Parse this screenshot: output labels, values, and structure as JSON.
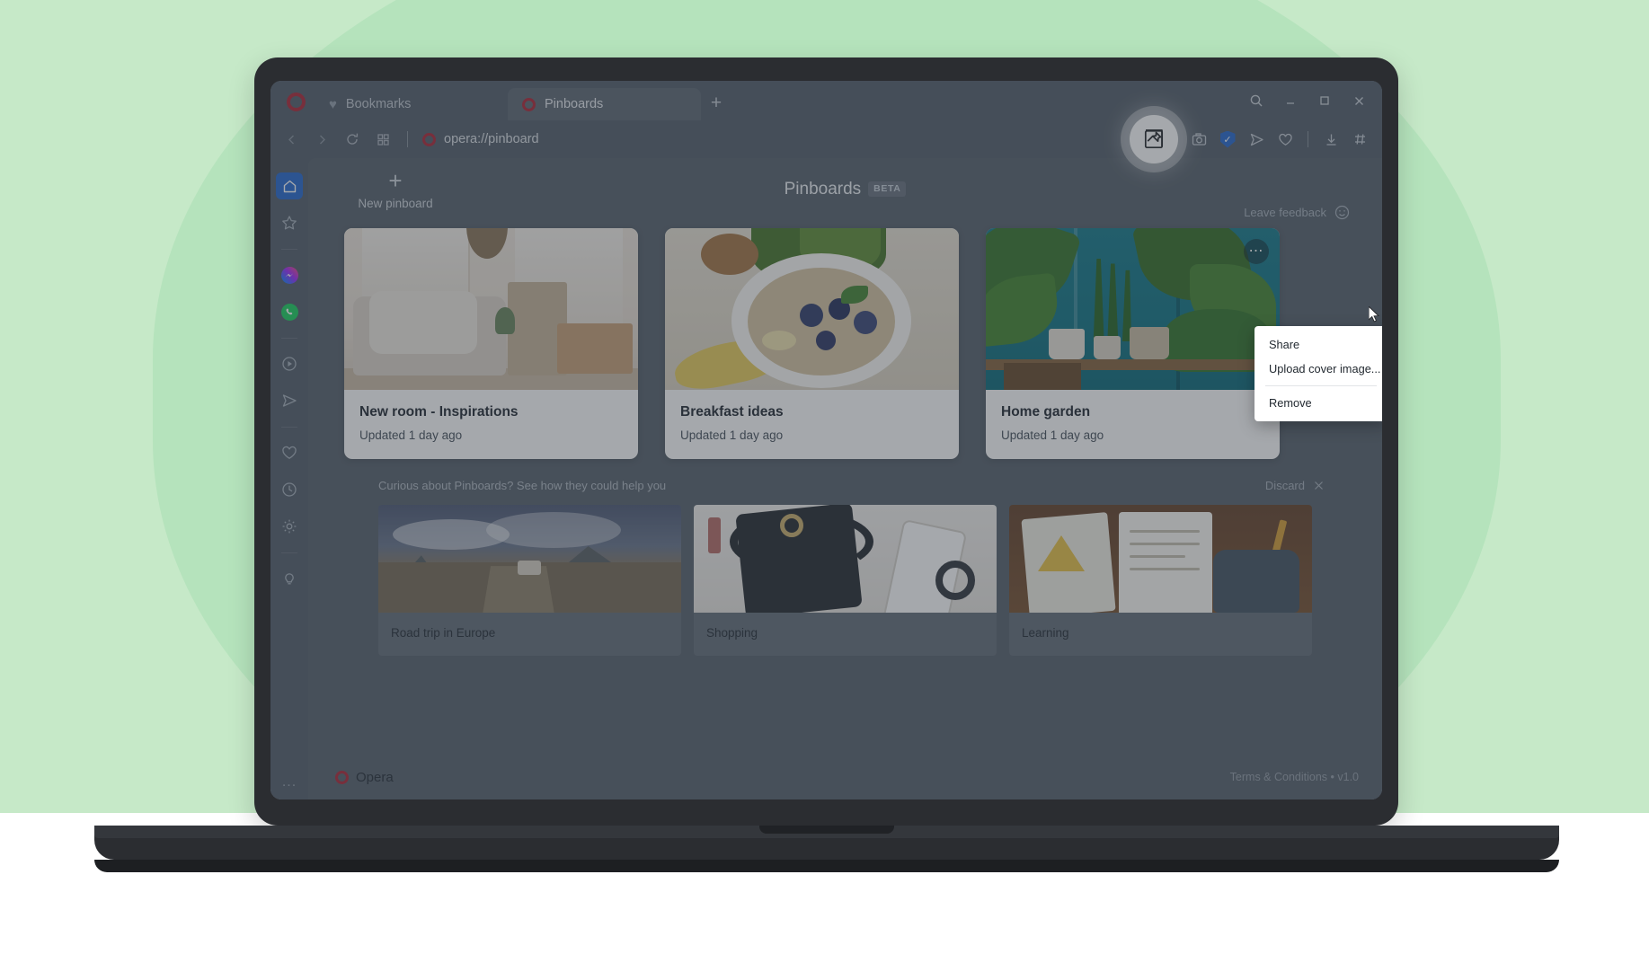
{
  "browser": {
    "tabs": [
      {
        "label": "Bookmarks",
        "icon": "heart-icon",
        "active": false
      },
      {
        "label": "Pinboards",
        "icon": "opera-icon",
        "active": true
      }
    ],
    "new_tab_label": "+",
    "window_controls": [
      {
        "name": "search-icon",
        "glyph": "search"
      },
      {
        "name": "minimize-icon",
        "glyph": "minimize"
      },
      {
        "name": "maximize-icon",
        "glyph": "maximize"
      },
      {
        "name": "close-icon",
        "glyph": "close"
      }
    ],
    "nav": {
      "back": "back-icon",
      "forward": "forward-icon",
      "reload": "reload-icon",
      "tab_islands": "tab-islands-icon"
    },
    "address": {
      "url": "opera://pinboard",
      "favicon": "opera-icon"
    },
    "toolbar_icons": [
      "pin-to-pinboard-icon",
      "snapshot-icon",
      "vpn-shield-icon",
      "send-icon",
      "heart-icon",
      "downloads-icon",
      "easy-setup-icon"
    ]
  },
  "sidebar": {
    "items": [
      {
        "name": "sidebar-item-home",
        "icon": "home-icon",
        "active": true
      },
      {
        "name": "sidebar-item-favorites",
        "icon": "star-icon",
        "active": false
      },
      {
        "name": "sidebar-item-messenger",
        "icon": "messenger-icon",
        "active": false
      },
      {
        "name": "sidebar-item-whatsapp",
        "icon": "whatsapp-icon",
        "active": false
      },
      {
        "name": "sidebar-item-player",
        "icon": "player-icon",
        "active": false
      },
      {
        "name": "sidebar-item-telegram",
        "icon": "send-icon",
        "active": false
      },
      {
        "name": "sidebar-item-pinboards",
        "icon": "heart-icon",
        "active": false
      },
      {
        "name": "sidebar-item-history",
        "icon": "clock-icon",
        "active": false
      },
      {
        "name": "sidebar-item-settings",
        "icon": "gear-icon",
        "active": false
      },
      {
        "name": "sidebar-item-tips",
        "icon": "lightbulb-icon",
        "active": false
      }
    ],
    "more_label": "..."
  },
  "pinboards": {
    "new_pinboard_label": "New pinboard",
    "new_pinboard_icon": "plus-icon",
    "title": "Pinboards",
    "badge": "BETA",
    "feedback_label": "Leave feedback",
    "feedback_icon": "smiley-icon",
    "cards": [
      {
        "title": "New room - Inspirations",
        "subtitle": "Updated 1 day ago",
        "cover": "living-room-photo",
        "menu_open": false
      },
      {
        "title": "Breakfast ideas",
        "subtitle": "Updated 1 day ago",
        "cover": "smoothie-bowl-photo",
        "menu_open": false
      },
      {
        "title": "Home garden",
        "subtitle": "Updated 1 day ago",
        "cover": "indoor-plants-photo",
        "menu_open": true
      }
    ],
    "context_menu": {
      "items": [
        "Share",
        "Upload cover image..."
      ],
      "destructive": "Remove"
    }
  },
  "promo": {
    "headline": "Curious about Pinboards? See how they could help you",
    "discard_label": "Discard",
    "discard_icon": "close-icon",
    "cards": [
      {
        "label": "Road trip in Europe",
        "cover": "mountain-road-photo"
      },
      {
        "label": "Shopping",
        "cover": "accessories-flatlay-photo"
      },
      {
        "label": "Learning",
        "cover": "notebooks-desk-photo"
      }
    ]
  },
  "footer": {
    "brand": "Opera",
    "brand_icon": "opera-icon",
    "legal": "Terms & Conditions • v1.0"
  },
  "colors": {
    "accent_blue": "#2f6fd0",
    "opera_red": "#b0303f",
    "chrome_bg": "#5b6570",
    "content_bg": "#5e6872",
    "page_green": "#c6e9c8",
    "page_green_blob": "#b5e3bc"
  }
}
